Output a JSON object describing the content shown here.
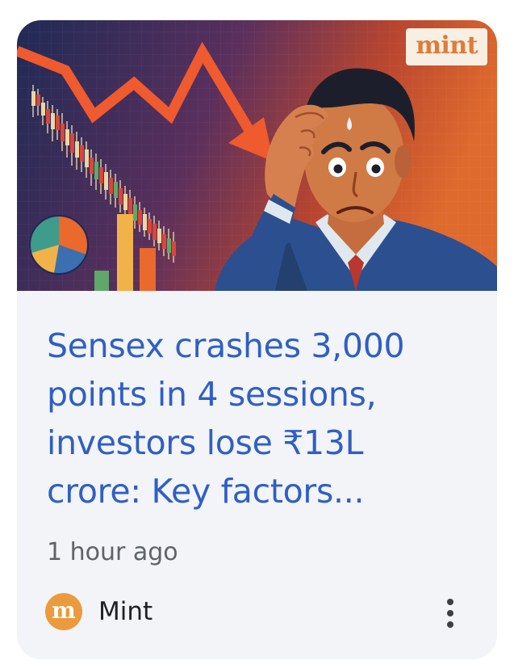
{
  "card": {
    "image": {
      "alt": "Stressed investor with falling market chart",
      "brand_badge": "mint",
      "colors": {
        "arrow": "#ef5a2f",
        "background_dark": "#2a2b5a",
        "background_warm": "#d25a2c",
        "jacket": "#2c4f8f"
      }
    },
    "headline": "Sensex crashes 3,000 points in 4 sessions, investors lose ₹13L crore: Key factors...",
    "headline_lines": "Sensex crashes 3,000\npoints in 4 sessions,\ninvestors lose ₹13L\ncrore: Key factors...",
    "timestamp": "1 hour ago",
    "source": {
      "logo_letter": "m",
      "name": "Mint",
      "logo_color": "#eb9a3d"
    },
    "more_icon": "more-vert-icon",
    "colors": {
      "headline": "#2f5fc4",
      "card_bg": "#f2f4f7",
      "meta_text": "#5f6368"
    }
  }
}
